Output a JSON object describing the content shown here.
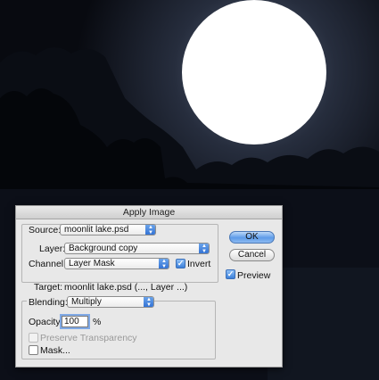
{
  "dialog": {
    "title": "Apply Image",
    "source": {
      "label": "Source:",
      "value": "moonlit lake.psd"
    },
    "layer": {
      "label": "Layer:",
      "value": "Background copy"
    },
    "channel": {
      "label": "Channel:",
      "value": "Layer Mask"
    },
    "invert": {
      "label": "Invert",
      "checked": true
    },
    "target": {
      "label": "Target:",
      "value": "moonlit lake.psd (..., Layer ...)"
    },
    "blending": {
      "label": "Blending:",
      "value": "Multiply"
    },
    "opacity": {
      "label": "Opacity:",
      "value": "100",
      "unit": "%"
    },
    "preserve_transparency": {
      "label": "Preserve Transparency",
      "checked": false,
      "enabled": false
    },
    "mask": {
      "label": "Mask...",
      "checked": false
    },
    "ok_label": "OK",
    "cancel_label": "Cancel",
    "preview": {
      "label": "Preview",
      "checked": true
    }
  }
}
